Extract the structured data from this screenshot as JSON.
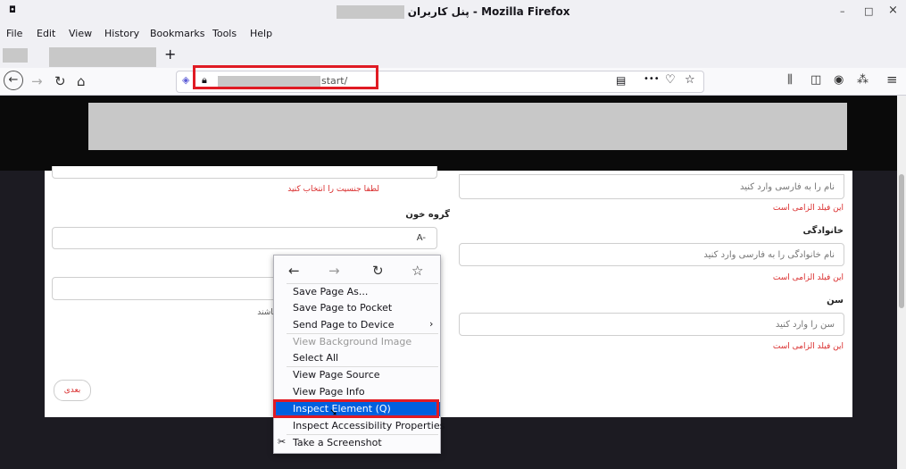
{
  "window": {
    "title_suffix": "پنل کاربران - Mozilla Firefox",
    "min_label": "–",
    "max_label": "□",
    "close_label": "×",
    "app_icon": "◘"
  },
  "menubar": {
    "items": [
      {
        "label": "File"
      },
      {
        "label": "Edit"
      },
      {
        "label": "View"
      },
      {
        "label": "History"
      },
      {
        "label": "Bookmarks"
      },
      {
        "label": "Tools"
      },
      {
        "label": "Help"
      }
    ]
  },
  "tabs": {
    "new_tab_label": "+"
  },
  "navbar": {
    "back": "←",
    "forward": "→",
    "reload": "↻",
    "home": "⌂",
    "url_visible": "start/",
    "reader": "▤",
    "more": "•••",
    "pocket": "♡",
    "bookmark": "☆",
    "library": "⫼",
    "sidebar": "◫",
    "account": "◉",
    "extension": "⁂",
    "menu": "≡"
  },
  "form": {
    "gender_error": "لطفا جنسیت را انتخاب کنید",
    "blood_label": "گروه خون",
    "blood_value": "A-",
    "phone_hint_partial": "ﮐﺎﺑﺎیت باشند",
    "name_placeholder": "نام را به فارسی وارد کنید",
    "name_error": "این فیلد الزامی است",
    "family_label": "خانوادگی",
    "family_placeholder": "نام خانوادگی را به فارسی وارد کنید",
    "family_error": "این فیلد الزامی است",
    "age_label": "سن",
    "age_placeholder": "سن را وارد کنید",
    "age_error": "این فیلد الزامی است",
    "next_button": "بعدی"
  },
  "context_menu": {
    "nav_back": "←",
    "nav_forward": "→",
    "nav_reload": "↻",
    "nav_bookmark": "☆",
    "items": [
      {
        "label": "Save Page As..."
      },
      {
        "label": "Save Page to Pocket"
      },
      {
        "label": "Send Page to Device"
      },
      {
        "label": "View Background Image"
      },
      {
        "label": "Select All"
      },
      {
        "label": "View Page Source"
      },
      {
        "label": "View Page Info"
      },
      {
        "label": "Inspect Element (Q)"
      },
      {
        "label": "Inspect Accessibility Properties"
      },
      {
        "label": "Take a Screenshot"
      }
    ],
    "submenu_arrow": "›"
  }
}
